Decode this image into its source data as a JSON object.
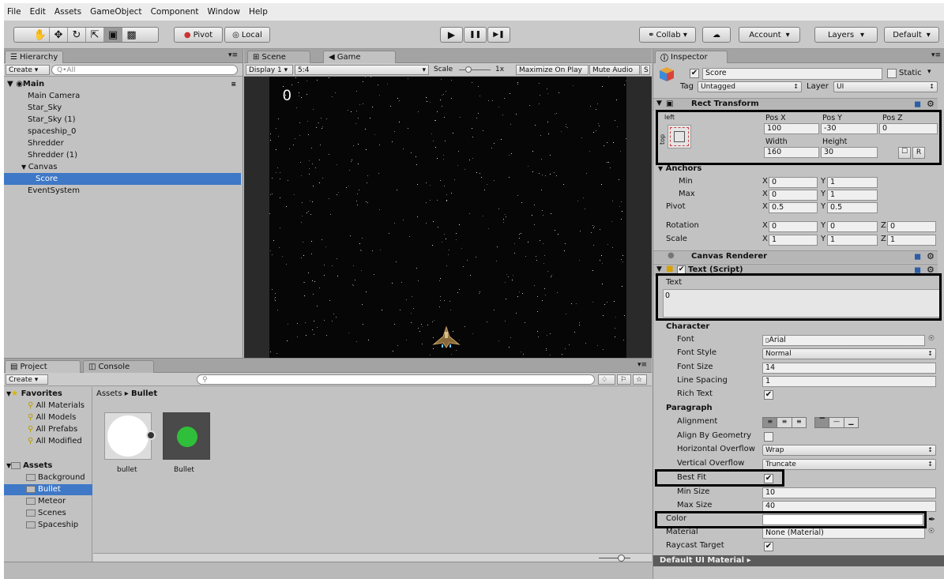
{
  "menu": [
    "File",
    "Edit",
    "Assets",
    "GameObject",
    "Component",
    "Window",
    "Help"
  ],
  "toolbar": {
    "tools": [
      "hand-icon",
      "move-icon",
      "rotate-icon",
      "scale-icon",
      "rect-icon",
      "transform-icon"
    ],
    "pivot": "Pivot",
    "local": "Local",
    "play": "▶",
    "pause": "❚❚",
    "step": "▶❚",
    "collab": "Collab ▾",
    "account": "Account",
    "layers": "Layers",
    "layout": "Default"
  },
  "hierarchy": {
    "tab": "Hierarchy",
    "create": "Create",
    "search": "Q•All",
    "scene": "Main",
    "items": [
      {
        "label": "Main Camera",
        "depth": 1
      },
      {
        "label": "Star_Sky",
        "depth": 1
      },
      {
        "label": "Star_Sky (1)",
        "depth": 1
      },
      {
        "label": "spaceship_0",
        "depth": 1
      },
      {
        "label": "Shredder",
        "depth": 1
      },
      {
        "label": "Shredder (1)",
        "depth": 1
      },
      {
        "label": "Canvas",
        "depth": 1,
        "expanded": true
      },
      {
        "label": "Score",
        "depth": 2,
        "selected": true
      },
      {
        "label": "EventSystem",
        "depth": 1
      }
    ]
  },
  "game": {
    "tab_scene": "Scene",
    "tab_game": "Game",
    "display": "Display 1",
    "aspect": "5:4",
    "scale_label": "Scale",
    "scale_value": "1x",
    "maximize": "Maximize On Play",
    "mute": "Mute Audio",
    "stats": "S",
    "score": "0"
  },
  "project": {
    "tab": "Project",
    "console": "Console",
    "create": "Create",
    "favorites_label": "Favorites",
    "favorites": [
      "All Materials",
      "All Models",
      "All Prefabs",
      "All Modified"
    ],
    "assets_label": "Assets",
    "folders": [
      "Background",
      "Bullet",
      "Meteor",
      "Scenes",
      "Spaceship"
    ],
    "selected_folder": "Bullet",
    "breadcrumb_root": "Assets",
    "breadcrumb_sep": "▸",
    "breadcrumb_leaf": "Bullet",
    "assets": [
      {
        "name": "bullet",
        "kind": "material"
      },
      {
        "name": "Bullet",
        "kind": "prefab"
      }
    ]
  },
  "inspector": {
    "tab": "Inspector",
    "name": "Score",
    "static": "Static",
    "tag_label": "Tag",
    "tag": "Untagged",
    "layer_label": "Layer",
    "layer": "UI",
    "rect_transform": "Rect Transform",
    "anchor_left": "left",
    "anchor_top": "top",
    "pos_x_label": "Pos X",
    "pos_y_label": "Pos Y",
    "pos_z_label": "Pos Z",
    "pos_x": "100",
    "pos_y": "-30",
    "pos_z": "0",
    "width_label": "Width",
    "height_label": "Height",
    "width": "160",
    "height": "30",
    "blueprint_btn": "☐",
    "raw_btn": "R",
    "anchors": "Anchors",
    "min": "Min",
    "max": "Max",
    "pivot": "Pivot",
    "min_x": "0",
    "min_y": "1",
    "max_x": "0",
    "max_y": "1",
    "pivot_x": "0.5",
    "pivot_y": "0.5",
    "rotation": "Rotation",
    "rot_x": "0",
    "rot_y": "0",
    "rot_z": "0",
    "scale": "Scale",
    "scale_x": "1",
    "scale_y": "1",
    "scale_z": "1",
    "x": "X",
    "y": "Y",
    "z": "Z",
    "canvas_renderer": "Canvas Renderer",
    "text_script": "Text (Script)",
    "text_label": "Text",
    "text_value": "0",
    "character": "Character",
    "font_label": "Font",
    "font": "Arial",
    "font_style_label": "Font Style",
    "font_style": "Normal",
    "font_size_label": "Font Size",
    "font_size": "14",
    "line_spacing_label": "Line Spacing",
    "line_spacing": "1",
    "rich_text_label": "Rich Text",
    "paragraph": "Paragraph",
    "alignment_label": "Alignment",
    "align_geom_label": "Align By Geometry",
    "h_overflow_label": "Horizontal Overflow",
    "h_overflow": "Wrap",
    "v_overflow_label": "Vertical Overflow",
    "v_overflow": "Truncate",
    "best_fit_label": "Best Fit",
    "min_size_label": "Min Size",
    "min_size": "10",
    "max_size_label": "Max Size",
    "max_size": "40",
    "color_label": "Color",
    "material_label": "Material",
    "material": "None (Material)",
    "raycast_label": "Raycast Target",
    "default_material": "Default UI Material",
    "check": "✔"
  },
  "colors": {
    "selection": "#3e78c7",
    "game_bg": "#0a0a0a",
    "highlight": "#000000",
    "bullet_green": "#2fbf3a"
  }
}
